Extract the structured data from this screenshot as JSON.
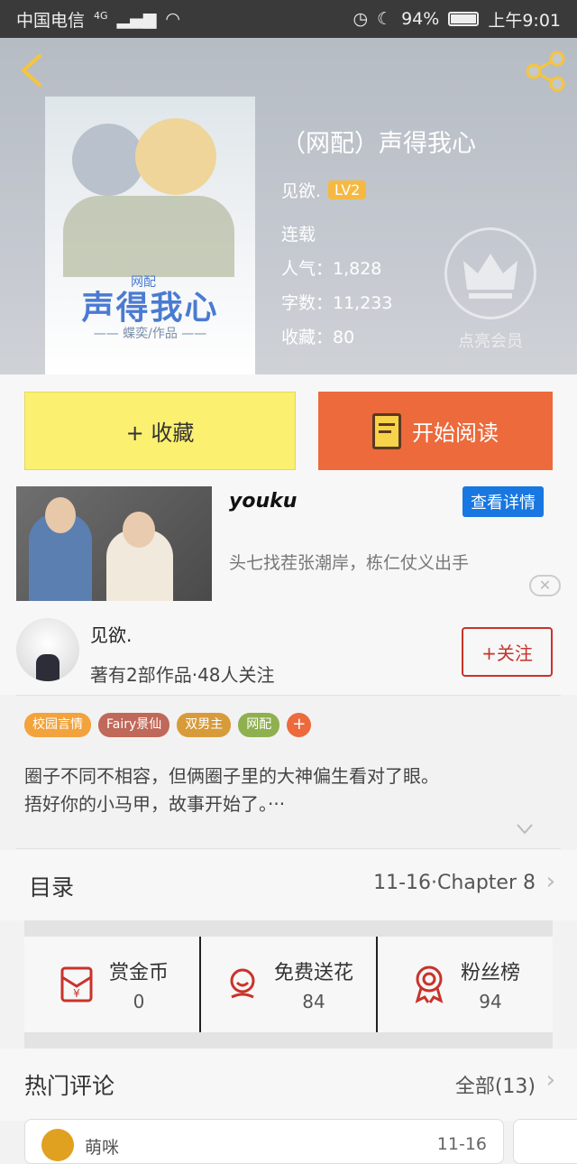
{
  "status_bar": {
    "carrier": "中国电信",
    "network": "4G",
    "battery_pct": "94%",
    "time": "上午9:01",
    "battery_level": 0.94
  },
  "book": {
    "cover_title": "声得我心",
    "cover_tag": "网配",
    "cover_sub": "—— 蝶奕/作品 ——",
    "title": "（网配）声得我心",
    "author": "见欲.",
    "level": "LV2",
    "status": "连载",
    "popularity": "人气：1,828",
    "word_count": "字数：11,233",
    "favorites": "收藏：80",
    "vip_label": "点亮会员"
  },
  "actions": {
    "favorite_label": "+ 收藏",
    "read_label": "开始阅读"
  },
  "ad": {
    "brand": "youku",
    "detail_label": "查看详情",
    "description": "头七找茬张潮岸，栋仁仗义出手",
    "close_label": "✕"
  },
  "author_card": {
    "name": "见欲.",
    "info": "著有2部作品·48人关注",
    "follow_label": "+关注"
  },
  "tags": [
    {
      "label": "校园言情",
      "color": "#f2a33c"
    },
    {
      "label": "Fairy景仙",
      "color": "#c0685a"
    },
    {
      "label": "双男主",
      "color": "#d89b3a"
    },
    {
      "label": "网配",
      "color": "#8fb04f"
    }
  ],
  "tag_add": "+",
  "description": {
    "line1": "圈子不同不相容，但俩圈子里的大神偏生看对了眼。",
    "line2": "捂好你的小马甲，故事开始了。···"
  },
  "toc": {
    "label": "目录",
    "latest": "11-16·Chapter 8"
  },
  "stats": [
    {
      "label": "赏金币",
      "value": "0",
      "icon": "red-envelope-icon"
    },
    {
      "label": "免费送花",
      "value": "84",
      "icon": "flower-icon"
    },
    {
      "label": "粉丝榜",
      "value": "94",
      "icon": "medal-icon"
    }
  ],
  "comments": {
    "title": "热门评论",
    "all_label": "全部(13)",
    "first": {
      "name": "萌咪",
      "date": "11-16"
    }
  },
  "colors": {
    "accent_orange": "#ec6a3c",
    "favorite_yellow": "#fbf070",
    "follow_red": "#c8332a",
    "ad_blue": "#1877e0"
  }
}
